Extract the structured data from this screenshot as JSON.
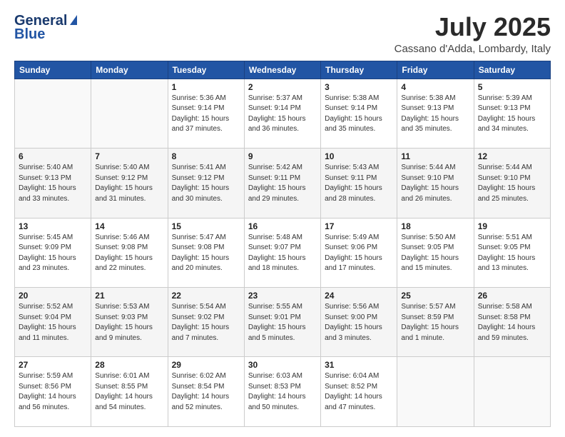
{
  "header": {
    "logo_line1": "General",
    "logo_line2": "Blue",
    "month_title": "July 2025",
    "location": "Cassano d'Adda, Lombardy, Italy"
  },
  "weekdays": [
    "Sunday",
    "Monday",
    "Tuesday",
    "Wednesday",
    "Thursday",
    "Friday",
    "Saturday"
  ],
  "weeks": [
    [
      {
        "day": "",
        "content": ""
      },
      {
        "day": "",
        "content": ""
      },
      {
        "day": "1",
        "content": "Sunrise: 5:36 AM\nSunset: 9:14 PM\nDaylight: 15 hours\nand 37 minutes."
      },
      {
        "day": "2",
        "content": "Sunrise: 5:37 AM\nSunset: 9:14 PM\nDaylight: 15 hours\nand 36 minutes."
      },
      {
        "day": "3",
        "content": "Sunrise: 5:38 AM\nSunset: 9:14 PM\nDaylight: 15 hours\nand 35 minutes."
      },
      {
        "day": "4",
        "content": "Sunrise: 5:38 AM\nSunset: 9:13 PM\nDaylight: 15 hours\nand 35 minutes."
      },
      {
        "day": "5",
        "content": "Sunrise: 5:39 AM\nSunset: 9:13 PM\nDaylight: 15 hours\nand 34 minutes."
      }
    ],
    [
      {
        "day": "6",
        "content": "Sunrise: 5:40 AM\nSunset: 9:13 PM\nDaylight: 15 hours\nand 33 minutes."
      },
      {
        "day": "7",
        "content": "Sunrise: 5:40 AM\nSunset: 9:12 PM\nDaylight: 15 hours\nand 31 minutes."
      },
      {
        "day": "8",
        "content": "Sunrise: 5:41 AM\nSunset: 9:12 PM\nDaylight: 15 hours\nand 30 minutes."
      },
      {
        "day": "9",
        "content": "Sunrise: 5:42 AM\nSunset: 9:11 PM\nDaylight: 15 hours\nand 29 minutes."
      },
      {
        "day": "10",
        "content": "Sunrise: 5:43 AM\nSunset: 9:11 PM\nDaylight: 15 hours\nand 28 minutes."
      },
      {
        "day": "11",
        "content": "Sunrise: 5:44 AM\nSunset: 9:10 PM\nDaylight: 15 hours\nand 26 minutes."
      },
      {
        "day": "12",
        "content": "Sunrise: 5:44 AM\nSunset: 9:10 PM\nDaylight: 15 hours\nand 25 minutes."
      }
    ],
    [
      {
        "day": "13",
        "content": "Sunrise: 5:45 AM\nSunset: 9:09 PM\nDaylight: 15 hours\nand 23 minutes."
      },
      {
        "day": "14",
        "content": "Sunrise: 5:46 AM\nSunset: 9:08 PM\nDaylight: 15 hours\nand 22 minutes."
      },
      {
        "day": "15",
        "content": "Sunrise: 5:47 AM\nSunset: 9:08 PM\nDaylight: 15 hours\nand 20 minutes."
      },
      {
        "day": "16",
        "content": "Sunrise: 5:48 AM\nSunset: 9:07 PM\nDaylight: 15 hours\nand 18 minutes."
      },
      {
        "day": "17",
        "content": "Sunrise: 5:49 AM\nSunset: 9:06 PM\nDaylight: 15 hours\nand 17 minutes."
      },
      {
        "day": "18",
        "content": "Sunrise: 5:50 AM\nSunset: 9:05 PM\nDaylight: 15 hours\nand 15 minutes."
      },
      {
        "day": "19",
        "content": "Sunrise: 5:51 AM\nSunset: 9:05 PM\nDaylight: 15 hours\nand 13 minutes."
      }
    ],
    [
      {
        "day": "20",
        "content": "Sunrise: 5:52 AM\nSunset: 9:04 PM\nDaylight: 15 hours\nand 11 minutes."
      },
      {
        "day": "21",
        "content": "Sunrise: 5:53 AM\nSunset: 9:03 PM\nDaylight: 15 hours\nand 9 minutes."
      },
      {
        "day": "22",
        "content": "Sunrise: 5:54 AM\nSunset: 9:02 PM\nDaylight: 15 hours\nand 7 minutes."
      },
      {
        "day": "23",
        "content": "Sunrise: 5:55 AM\nSunset: 9:01 PM\nDaylight: 15 hours\nand 5 minutes."
      },
      {
        "day": "24",
        "content": "Sunrise: 5:56 AM\nSunset: 9:00 PM\nDaylight: 15 hours\nand 3 minutes."
      },
      {
        "day": "25",
        "content": "Sunrise: 5:57 AM\nSunset: 8:59 PM\nDaylight: 15 hours\nand 1 minute."
      },
      {
        "day": "26",
        "content": "Sunrise: 5:58 AM\nSunset: 8:58 PM\nDaylight: 14 hours\nand 59 minutes."
      }
    ],
    [
      {
        "day": "27",
        "content": "Sunrise: 5:59 AM\nSunset: 8:56 PM\nDaylight: 14 hours\nand 56 minutes."
      },
      {
        "day": "28",
        "content": "Sunrise: 6:01 AM\nSunset: 8:55 PM\nDaylight: 14 hours\nand 54 minutes."
      },
      {
        "day": "29",
        "content": "Sunrise: 6:02 AM\nSunset: 8:54 PM\nDaylight: 14 hours\nand 52 minutes."
      },
      {
        "day": "30",
        "content": "Sunrise: 6:03 AM\nSunset: 8:53 PM\nDaylight: 14 hours\nand 50 minutes."
      },
      {
        "day": "31",
        "content": "Sunrise: 6:04 AM\nSunset: 8:52 PM\nDaylight: 14 hours\nand 47 minutes."
      },
      {
        "day": "",
        "content": ""
      },
      {
        "day": "",
        "content": ""
      }
    ]
  ]
}
